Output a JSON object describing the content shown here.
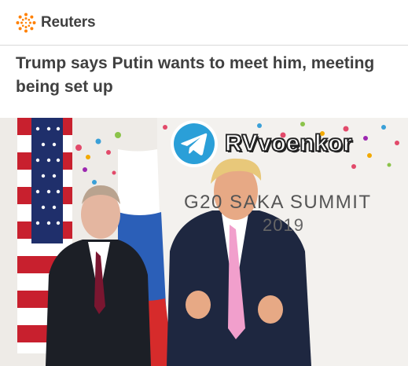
{
  "header": {
    "logo_text": "Reuters",
    "brand_color": "#ff8000",
    "logo_icon": "reuters-dots-logo"
  },
  "article": {
    "headline": "Trump says Putin wants to meet him, meeting being set up"
  },
  "photo": {
    "watermark_text": "RVvoenkor",
    "watermark_icon": "telegram-icon",
    "backdrop_text": "G20 SAKA SUMMIT",
    "backdrop_year": "2019"
  }
}
